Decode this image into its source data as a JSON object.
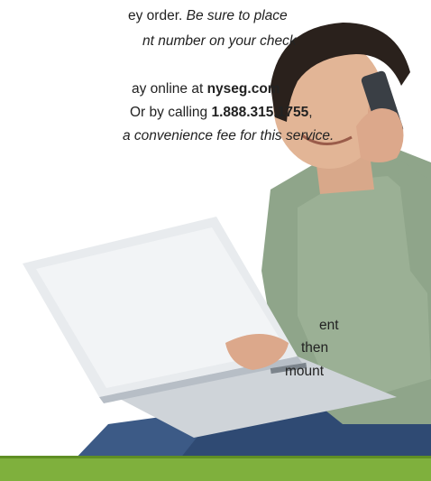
{
  "text": {
    "line1_plain": "ey order. ",
    "line1_italic": "Be sure to place",
    "line2_italic": "nt number on your check",
    "line3_plain": "ay online at ",
    "line3_bold": "nyseg.com",
    "line4_plain": "Or by calling ",
    "line4_bold": "1.888.315.1755",
    "line4_tail": ",",
    "line5_italic": "a convenience fee for this service.",
    "line6": "ent",
    "line7": "then",
    "line8": "mount"
  },
  "colors": {
    "footer_green": "#7fb03d",
    "shirt": "#8fa58a",
    "jeans": "#3c5a86",
    "laptop": "#e8ebee"
  }
}
